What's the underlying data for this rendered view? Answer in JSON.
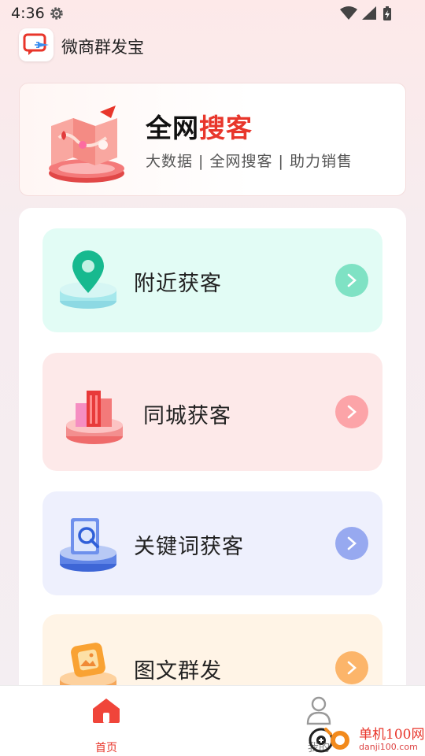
{
  "status_bar": {
    "time": "4:36"
  },
  "app": {
    "title": "微商群发宝"
  },
  "banner": {
    "title_black": "全网",
    "title_red": "搜客",
    "subtitle": "大数据 | 全网搜客 | 助力销售"
  },
  "features": [
    {
      "label": "附近获客",
      "icon": "location-pin-icon",
      "bg": "#e2fcf5",
      "arrow_color": "#7fe2c4"
    },
    {
      "label": "同城获客",
      "icon": "city-buildings-icon",
      "bg": "#fde9e9",
      "arrow_color": "#fca4a8"
    },
    {
      "label": "关键词获客",
      "icon": "keyword-search-icon",
      "bg": "#eef0fd",
      "arrow_color": "#97a9f0"
    },
    {
      "label": "图文群发",
      "icon": "image-broadcast-icon",
      "bg": "#fff4e6",
      "arrow_color": "#fcb56a"
    }
  ],
  "bottom_nav": {
    "home_label": "首页",
    "mine_label": "我的"
  },
  "watermark": {
    "brand": "单机100网",
    "url": "danji100.com"
  },
  "colors": {
    "accent_red": "#e8362b"
  }
}
